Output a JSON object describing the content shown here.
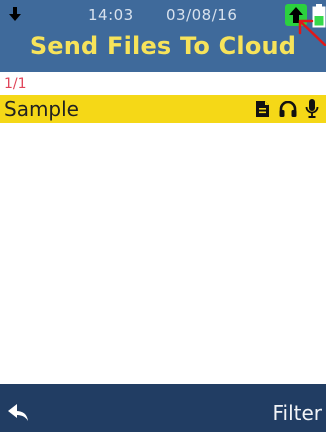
{
  "status": {
    "time": "14:03",
    "date": "03/08/16"
  },
  "header": {
    "title": "Send Files To Cloud"
  },
  "list": {
    "counter": "1/1",
    "items": [
      {
        "label": "Sample",
        "icons": [
          "document-icon",
          "headphones-icon",
          "microphone-icon"
        ]
      }
    ]
  },
  "footer": {
    "back_icon": "back-arrow-icon",
    "filter_label": "Filter"
  },
  "icons": {
    "status_left": "download-arrow-icon",
    "status_upload": "upload-arrow-icon",
    "status_battery": "battery-icon",
    "annotation": "red-pointer-arrow"
  },
  "colors": {
    "header_bg": "#3f6a9b",
    "title": "#f7e35a",
    "counter": "#e0455a",
    "selected_row": "#f5d817",
    "footer_bg": "#213d63",
    "upload_badge": "#2bd13e",
    "battery_fill": "#35d94a",
    "annotation": "#e01818"
  }
}
